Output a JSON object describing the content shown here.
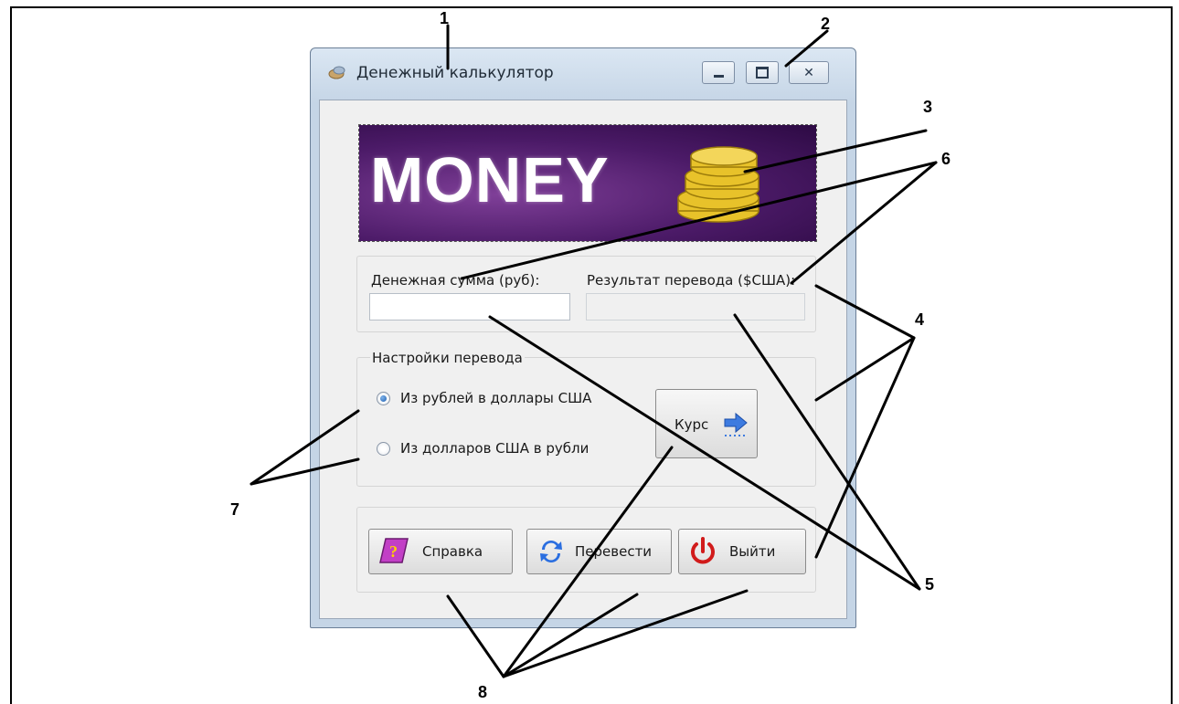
{
  "window": {
    "title": "Денежный калькулятор",
    "app_icon": "money-calculator-icon"
  },
  "banner": {
    "text": "MONEY",
    "icon": "coins-stack-icon"
  },
  "input_group": {
    "amount_label": "Денежная сумма (руб):",
    "amount_value": "",
    "result_label": "Результат перевода ($США):",
    "result_value": ""
  },
  "settings_group": {
    "title": "Настройки перевода",
    "options": [
      {
        "label": "Из рублей в доллары США",
        "selected": true
      },
      {
        "label": "Из долларов США в рубли",
        "selected": false
      }
    ],
    "rate_button": "Курс"
  },
  "actions": {
    "help": "Справка",
    "convert": "Перевести",
    "exit": "Выйти"
  },
  "annotations": [
    "1",
    "2",
    "3",
    "4",
    "5",
    "6",
    "7",
    "8"
  ]
}
